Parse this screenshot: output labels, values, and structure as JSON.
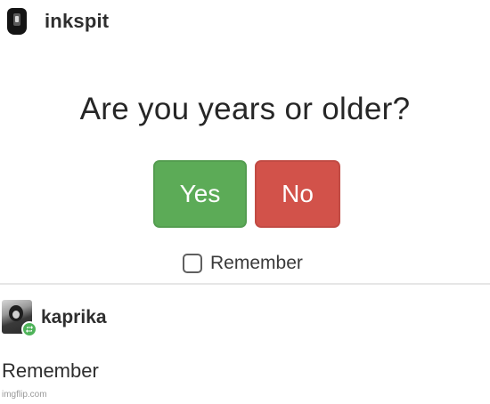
{
  "post": {
    "username": "inkspit",
    "avatar_icon": "hooded-figure-avatar",
    "question": "Are you years or older?",
    "buttons": {
      "yes_label": "Yes",
      "no_label": "No"
    },
    "remember": {
      "label": "Remember",
      "checked": false
    }
  },
  "reply": {
    "username": "kaprika",
    "avatar_icon": "user-photo-avatar",
    "badge_icon": "reblog-icon",
    "body": "Remember"
  },
  "watermark": "imgflip.com",
  "colors": {
    "yes_button": "#5cab57",
    "no_button": "#d2524a",
    "reblog_badge": "#4fb35a",
    "background": "#ffffff"
  }
}
